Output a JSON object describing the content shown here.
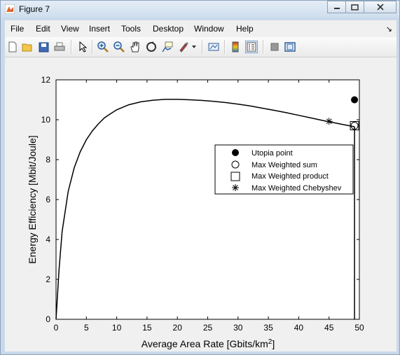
{
  "window": {
    "title": "Figure 7"
  },
  "menu": [
    "File",
    "Edit",
    "View",
    "Insert",
    "Tools",
    "Desktop",
    "Window",
    "Help"
  ],
  "toolbar": {
    "icons": [
      "new-figure-icon",
      "open-file-icon",
      "save-icon",
      "print-icon",
      "pointer-icon",
      "zoom-in-icon",
      "zoom-out-icon",
      "pan-icon",
      "rotate-3d-icon",
      "data-cursor-icon",
      "brush-icon",
      "dropdown-arrow-icon",
      "link-plot-icon",
      "insert-colorbar-icon",
      "insert-legend-icon",
      "hide-plot-tools-icon",
      "show-plot-tools-icon"
    ]
  },
  "chart_data": {
    "type": "line",
    "xlabel": "Average Area Rate [Gbits/km",
    "xlabel_sup": "2",
    "xlabel_end": "]",
    "ylabel": "Energy Efficiency [Mbit/Joule]",
    "xlim": [
      0,
      50
    ],
    "ylim": [
      0,
      12
    ],
    "xticks": [
      0,
      5,
      10,
      15,
      20,
      25,
      30,
      35,
      40,
      45,
      50
    ],
    "yticks": [
      0,
      2,
      4,
      6,
      8,
      10,
      12
    ],
    "curve": {
      "x": [
        0,
        0.5,
        1,
        2,
        3,
        4,
        5,
        6,
        7,
        8,
        9,
        10,
        12,
        14,
        16,
        18,
        20,
        22,
        24,
        26,
        28,
        30,
        32,
        34,
        36,
        38,
        40,
        42,
        44,
        46,
        48,
        49.2
      ],
      "y": [
        0,
        2.5,
        4.4,
        6.4,
        7.6,
        8.4,
        9.0,
        9.45,
        9.8,
        10.1,
        10.3,
        10.5,
        10.75,
        10.9,
        10.98,
        11.02,
        11.02,
        11.0,
        10.97,
        10.92,
        10.86,
        10.78,
        10.69,
        10.58,
        10.47,
        10.35,
        10.22,
        10.09,
        9.96,
        9.84,
        9.72,
        9.65
      ]
    },
    "vertical_line": {
      "x": 49.2,
      "y_from": 0,
      "y_to": 9.65
    },
    "points": [
      {
        "name": "Utopia point",
        "marker": "filled-circle",
        "x": 49.2,
        "y": 11.0
      },
      {
        "name": "Max Weighted sum",
        "marker": "circle",
        "x": 49.2,
        "y": 9.7
      },
      {
        "name": "Max Weighted product",
        "marker": "square",
        "x": 49.2,
        "y": 9.7
      },
      {
        "name": "Max Weighted Chebyshev",
        "marker": "asterisk",
        "x": 45.0,
        "y": 9.92
      }
    ],
    "legend": {
      "position": "right-middle",
      "entries": [
        "Utopia point",
        "Max Weighted sum",
        "Max Weighted product",
        "Max Weighted Chebyshev"
      ]
    },
    "grid": false
  }
}
